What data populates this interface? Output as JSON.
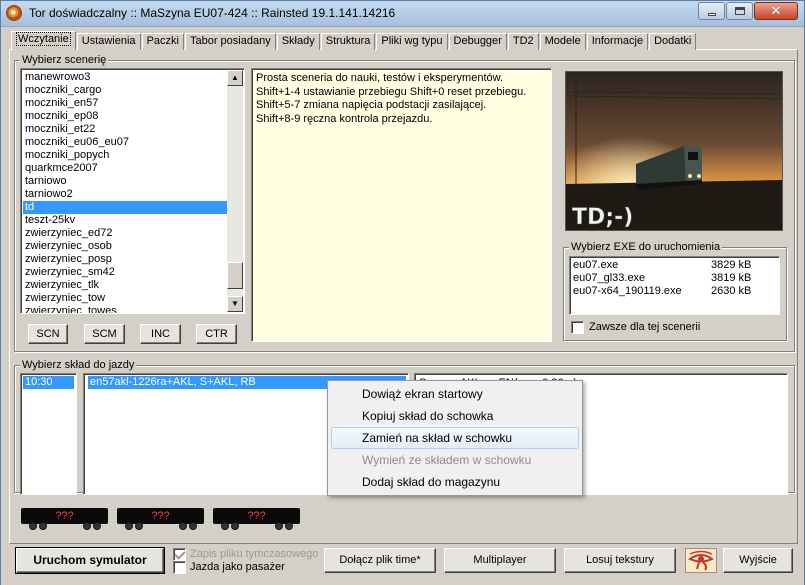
{
  "window": {
    "title": "Tor doświadczalny :: MaSzyna EU07-424 :: Rainsted 19.1.141.14216",
    "close_glyph": "✕"
  },
  "tabs": [
    {
      "label": "Wczytanie",
      "active": true
    },
    {
      "label": "Ustawienia"
    },
    {
      "label": "Paczki"
    },
    {
      "label": "Tabor posiadany"
    },
    {
      "label": "Składy"
    },
    {
      "label": "Struktura"
    },
    {
      "label": "Pliki wg typu"
    },
    {
      "label": "Debugger"
    },
    {
      "label": "TD2"
    },
    {
      "label": "Modele"
    },
    {
      "label": "Informacje"
    },
    {
      "label": "Dodatki"
    }
  ],
  "scenery": {
    "group_label": "Wybierz scenerię",
    "items": [
      "manewrowo3",
      "moczniki_cargo",
      "moczniki_en57",
      "moczniki_ep08",
      "moczniki_et22",
      "moczniki_eu06_eu07",
      "moczniki_popych",
      "quarkmce2007",
      "tarniowo",
      "tarniowo2",
      "td",
      "teszt-25kv",
      "zwierzyniec_ed72",
      "zwierzyniec_osob",
      "zwierzyniec_posp",
      "zwierzyniec_sm42",
      "zwierzyniec_tlk",
      "zwierzyniec_tow",
      "zwierzyniec_towes"
    ],
    "selected_index": 10,
    "buttons": [
      "SCN",
      "SCM",
      "INC",
      "CTR"
    ],
    "description": [
      "Prosta sceneria do nauki, testów i eksperymentów.",
      "Shift+1-4 ustawianie przebiegu Shift+0 reset przebiegu.",
      "Shift+5-7 zmiana napięcia podstacji zasilającej.",
      "Shift+8-9 ręczna kontrola przejazdu."
    ],
    "scroll_up": "▲",
    "scroll_down": "▼"
  },
  "preview": {
    "logo_text": "TD;-)"
  },
  "exe": {
    "group_label": "Wybierz EXE do uruchomienia",
    "items": [
      {
        "name": "eu07.exe",
        "size": "3829 kB"
      },
      {
        "name": "eu07_gl33.exe",
        "size": "3819 kB"
      },
      {
        "name": "eu07-x64_190119.exe",
        "size": "2630 kB"
      }
    ],
    "always_label": "Zawsze dla tej scenerii"
  },
  "consist": {
    "group_label": "Wybierz skład do jazdy",
    "times": [
      "10:30"
    ],
    "consists": [
      "en57akl-1226ra+AKL, S+AKL, RB"
    ],
    "detail_text": "S          .AKL      EN(        0 26ra)."
  },
  "context_menu": {
    "items": [
      {
        "label": "Dowiąż ekran startowy"
      },
      {
        "label": "Kopiuj skład do schowka"
      },
      {
        "label": "Zamień na skład w schowku",
        "hover": true
      },
      {
        "label": "Wymień ze składem w schowku",
        "disabled": true
      },
      {
        "label": "Dodaj skład do magazynu"
      }
    ]
  },
  "wagons": [
    "???",
    "???",
    "???"
  ],
  "bottom": {
    "run_button": "Uruchom symulator",
    "temp_file_label": "Zapis pliku tymczasowego",
    "passenger_label": "Jazda jako pasażer",
    "attach_time": "Dołącz plik time*",
    "multiplayer": "Multiplayer",
    "random_textures": "Losuj tekstury",
    "exit": "Wyjście"
  }
}
